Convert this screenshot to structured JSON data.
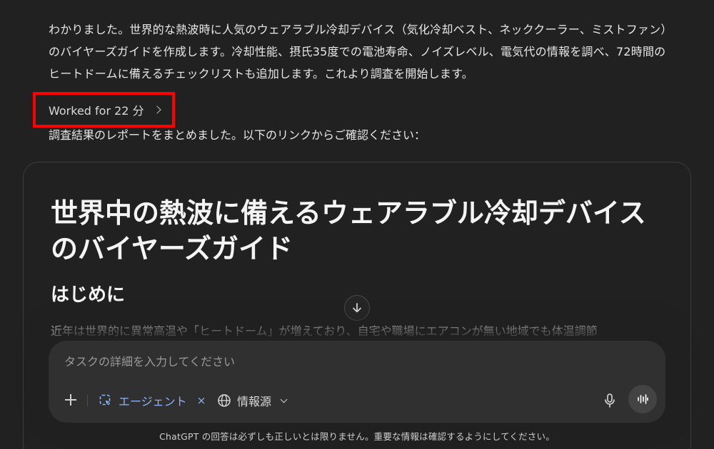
{
  "chat": {
    "intro_text": "わかりました。世界的な熱波時に人気のウェアラブル冷却デバイス（気化冷却ベスト、ネッククーラー、ミストファン）のバイヤーズガイドを作成します。冷却性能、摂氏35度での電池寿命、ノイズレベル、電気代の情報を調べ、72時間のヒートドームに備えるチェックリストも追加します。これより調査を開始します。",
    "worked_label": "Worked for 22 分",
    "result_text": "調査結果のレポートをまとめました。以下のリンクからご確認ください："
  },
  "report": {
    "title": "世界中の熱波に備えるウェアラブル冷却デバイスのバイヤーズガイド",
    "section_heading": "はじめに",
    "paragraph": "近年は世界的に異常高温や「ヒートドーム」が増えており、自宅や職場にエアコンが無い地域でも体温調節"
  },
  "composer": {
    "placeholder": "タスクの詳細を入力してください",
    "agent_label": "エージェント",
    "agent_remove": "×",
    "sources_label": "情報源"
  },
  "footer": {
    "disclaimer": "ChatGPT の回答は必ずしも正しいとは限りません。重要な情報は確認するようにしてください。"
  },
  "colors": {
    "background": "#212121",
    "composer_bg": "#303030",
    "accent_blue": "#8ab4f8",
    "highlight_red": "#ff0000"
  }
}
